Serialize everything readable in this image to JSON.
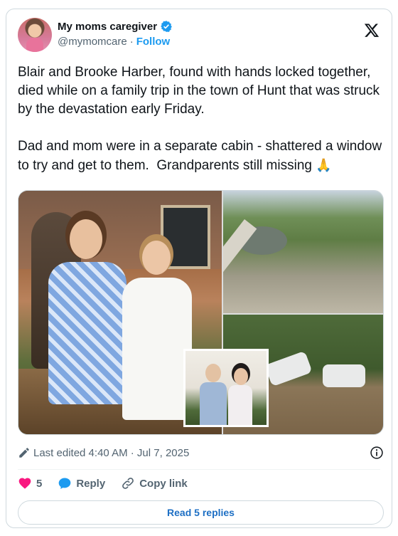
{
  "author": {
    "display_name": "My moms caregiver",
    "handle": "@mymomcare",
    "separator": "·",
    "follow_label": "Follow",
    "verified": true
  },
  "tweet": {
    "text": "Blair and Brooke Harber, found with hands locked together, died while on a family trip in the town of Hunt that was struck by the devastation early Friday.\n\nDad and mom were in a separate cabin - shattered a window to try and get to them.  Grandparents still missing ",
    "emoji": "🙏"
  },
  "media": {
    "images": [
      {
        "name": "girls-photo"
      },
      {
        "name": "flood-aerial-photo"
      },
      {
        "name": "flooded-cars-photo"
      },
      {
        "name": "grandparents-photo"
      }
    ]
  },
  "meta": {
    "edited_label": "Last edited 4:40 AM · Jul 7, 2025"
  },
  "actions": {
    "like_count": "5",
    "reply_label": "Reply",
    "copy_link_label": "Copy link"
  },
  "replies_button": "Read 5 replies",
  "colors": {
    "accent": "#1d9bf0",
    "like": "#f91880",
    "reply_icon": "#1d9bf0",
    "text_secondary": "#536471"
  },
  "icons": [
    "verified-badge-icon",
    "x-logo-icon",
    "edit-pencil-icon",
    "info-icon",
    "heart-icon",
    "reply-bubble-icon",
    "link-icon"
  ]
}
